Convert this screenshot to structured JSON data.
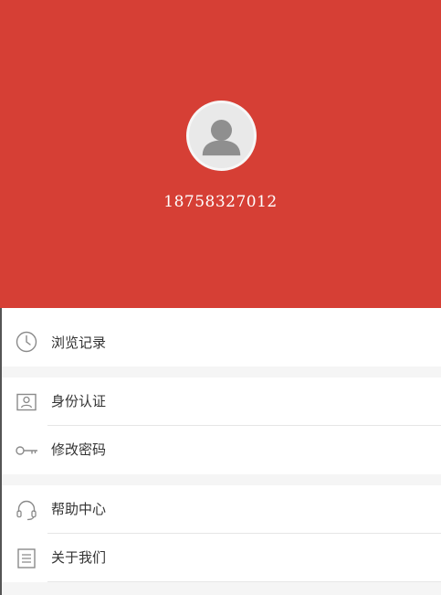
{
  "profile": {
    "phone": "18758327012"
  },
  "menu": {
    "history": {
      "label": "浏览记录",
      "icon": "clock-icon"
    },
    "identity": {
      "label": "身份认证",
      "icon": "id-card-icon"
    },
    "password": {
      "label": "修改密码",
      "icon": "key-icon"
    },
    "help": {
      "label": "帮助中心",
      "icon": "headset-icon"
    },
    "about": {
      "label": "关于我们",
      "icon": "document-icon"
    }
  },
  "colors": {
    "header_bg": "#d63f35",
    "page_bg": "#f5f5f5"
  }
}
